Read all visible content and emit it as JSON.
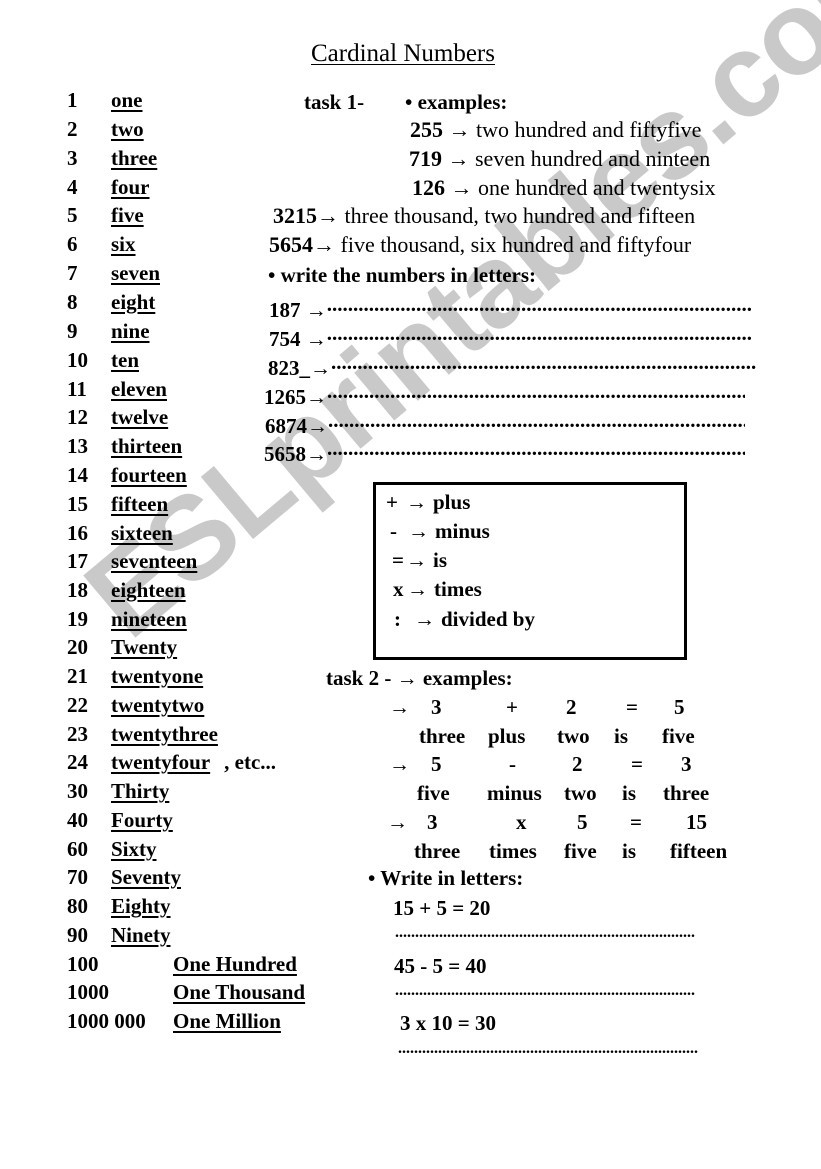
{
  "watermark": "ESLprintables.com",
  "title": "Cardinal Numbers",
  "numbers": [
    {
      "n": "1",
      "w": "one"
    },
    {
      "n": "2",
      "w": "two"
    },
    {
      "n": "3",
      "w": "three"
    },
    {
      "n": "4",
      "w": "four"
    },
    {
      "n": "5",
      "w": "five"
    },
    {
      "n": "6",
      "w": "six"
    },
    {
      "n": "7",
      "w": "seven"
    },
    {
      "n": "8",
      "w": "eight"
    },
    {
      "n": "9",
      "w": "nine"
    },
    {
      "n": "10",
      "w": "ten"
    },
    {
      "n": "11",
      "w": "eleven"
    },
    {
      "n": "12",
      "w": "twelve"
    },
    {
      "n": "13",
      "w": "thirteen"
    },
    {
      "n": "14",
      "w": "fourteen"
    },
    {
      "n": "15",
      "w": "fifteen"
    },
    {
      "n": "16",
      "w": "sixteen"
    },
    {
      "n": "17",
      "w": "seventeen"
    },
    {
      "n": "18",
      "w": "eighteen"
    },
    {
      "n": "19",
      "w": "nineteen"
    },
    {
      "n": "20",
      "w": "Twenty"
    },
    {
      "n": "21",
      "w": "twentyone"
    },
    {
      "n": "22",
      "w": "twentytwo"
    },
    {
      "n": "23",
      "w": "twentythree"
    },
    {
      "n": "24",
      "w": "twentyfour",
      "suffix": ", etc..."
    },
    {
      "n": "30",
      "w": "Thirty"
    },
    {
      "n": "40",
      "w": "Fourty"
    },
    {
      "n": "60",
      "w": "Sixty"
    },
    {
      "n": "70",
      "w": "Seventy"
    },
    {
      "n": "80",
      "w": "Eighty"
    },
    {
      "n": "90",
      "w": "Ninety"
    },
    {
      "n": "100",
      "w": "One Hundred"
    },
    {
      "n": "1000",
      "w": "One Thousand"
    },
    {
      "n": "1000 000",
      "w": "One Million"
    }
  ],
  "task1": {
    "label": "task 1-",
    "examples_heading": "• examples:",
    "examples": [
      {
        "num": "255",
        "arrow": " → ",
        "text": "two hundred and fiftyfive"
      },
      {
        "num": "719",
        "arrow": " → ",
        "text": "seven hundred and ninteen"
      },
      {
        "num": "126",
        "arrow": " → ",
        "text": "one hundred and twentysix"
      },
      {
        "num": "3215",
        "arrow": "→ ",
        "text": "three thousand, two hundred and fifteen"
      },
      {
        "num": "5654",
        "arrow": "→ ",
        "text": "five thousand, six hundred and fiftyfour"
      }
    ],
    "exercise_heading": "• write the numbers in letters:",
    "exercises": [
      {
        "num": "187",
        "arrow": " →"
      },
      {
        "num": "754",
        "arrow": " →"
      },
      {
        "num": "823",
        "arrow": "_→"
      },
      {
        "num": "1265",
        "arrow": "→"
      },
      {
        "num": "6874",
        "arrow": "→"
      },
      {
        "num": "5658",
        "arrow": "→"
      }
    ],
    "dots": "........................................................................................"
  },
  "operators_box": [
    {
      "sym": "+",
      "arrow": "→",
      "word": "plus"
    },
    {
      "sym": "-",
      "arrow": "→",
      "word": "minus"
    },
    {
      "sym": "=",
      "arrow": "→",
      "word": "is"
    },
    {
      "sym": "x",
      "arrow": "→",
      "word": "times"
    },
    {
      "sym": ":",
      "arrow": "→",
      "word": "divided by"
    }
  ],
  "task2": {
    "heading": "task 2 - → examples:",
    "arrow": "→",
    "equations": [
      {
        "digits": [
          "3",
          "+",
          "2",
          "=",
          "5"
        ],
        "words": [
          "three",
          "plus",
          "two",
          "is",
          "five"
        ]
      },
      {
        "digits": [
          "5",
          "-",
          "2",
          "=",
          "3"
        ],
        "words": [
          "five",
          "minus",
          "two",
          "is",
          "three"
        ]
      },
      {
        "digits": [
          "3",
          "x",
          "5",
          "=",
          "15"
        ],
        "words": [
          "three",
          "times",
          "five",
          "is",
          "fifteen"
        ]
      }
    ],
    "write_heading": "• Write in letters:",
    "write_items": [
      "15 +  5 = 20",
      "45 -  5  = 40",
      "3  x  10 = 30"
    ],
    "dots": "..........................................................................."
  }
}
